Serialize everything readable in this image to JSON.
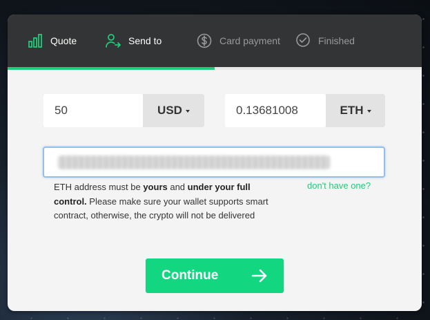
{
  "steps": [
    {
      "label": "Quote",
      "icon": "bar-chart-icon",
      "state": "active"
    },
    {
      "label": "Send to",
      "icon": "user-arrow-icon",
      "state": "active"
    },
    {
      "label": "Card payment",
      "icon": "dollar-circle-icon",
      "state": "inactive"
    },
    {
      "label": "Finished",
      "icon": "check-circle-icon",
      "state": "inactive"
    }
  ],
  "progress": {
    "completed_steps": 2,
    "total_steps": 4
  },
  "colors": {
    "accent": "#1fcc79",
    "header_bg": "#333435",
    "card_bg": "#f4f4f4",
    "button_bg": "#13d681",
    "focus_border": "#94bfe8"
  },
  "quote": {
    "fiat_amount": "50",
    "fiat_currency": "USD",
    "crypto_amount": "0.13681008",
    "crypto_currency": "ETH"
  },
  "address": {
    "value": "",
    "obscured": true
  },
  "note": {
    "part1": "ETH address must be ",
    "bold1": "yours",
    "part2": " and ",
    "bold2": "under your full control.",
    "part3": " Please make sure your wallet supports smart contract, otherwise, the crypto will not be delivered"
  },
  "help_link": "don't have one?",
  "continue_label": "Continue"
}
